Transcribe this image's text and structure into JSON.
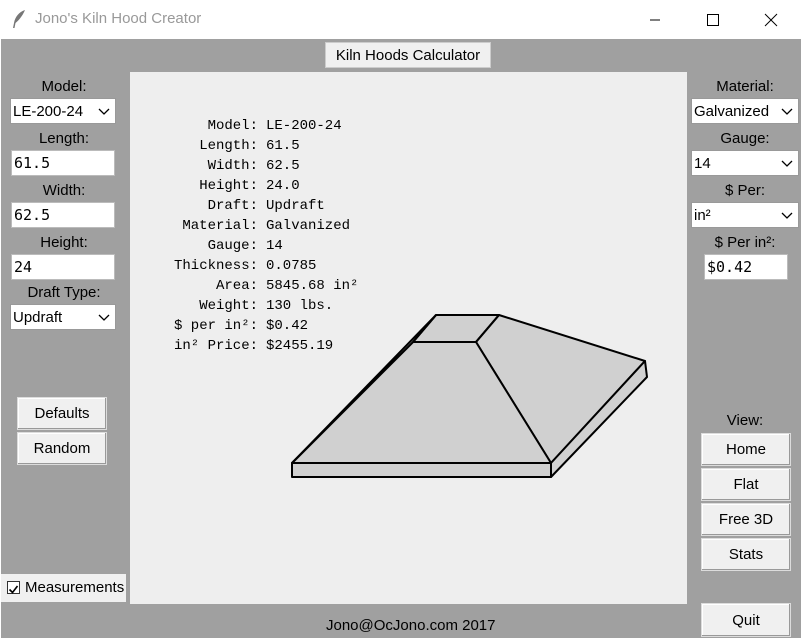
{
  "window": {
    "title": "Jono's Kiln Hood Creator",
    "minimize_icon": "minimize-icon",
    "maximize_icon": "maximize-icon",
    "close_icon": "close-icon",
    "app_icon": "feather-icon"
  },
  "header": {
    "calculator_label": "Kiln Hoods Calculator"
  },
  "left_panel": {
    "model_label": "Model:",
    "model_value": "LE-200-24",
    "length_label": "Length:",
    "length_value": "61.5",
    "width_label": "Width:",
    "width_value": "62.5",
    "height_label": "Height:",
    "height_value": "24",
    "draft_label": "Draft Type:",
    "draft_value": "Updraft",
    "defaults_label": "Defaults",
    "random_label": "Random",
    "measurements_label": "Measurements",
    "measurements_checked": true
  },
  "right_panel": {
    "material_label": "Material:",
    "material_value": "Galvanized",
    "gauge_label": "Gauge:",
    "gauge_value": "14",
    "per_label": "$ Per:",
    "per_value": "in²",
    "per_unit_label": "$ Per in²:",
    "per_unit_value": "$0.42",
    "view_label": "View:",
    "home_label": "Home",
    "flat_label": "Flat",
    "free3d_label": "Free 3D",
    "stats_label": "Stats",
    "quit_label": "Quit"
  },
  "stats": [
    {
      "key": "Model:",
      "value": "LE-200-24"
    },
    {
      "key": "Length:",
      "value": "61.5"
    },
    {
      "key": "Width:",
      "value": "62.5"
    },
    {
      "key": "Height:",
      "value": "24.0"
    },
    {
      "key": "Draft:",
      "value": "Updraft"
    },
    {
      "key": "Material:",
      "value": "Galvanized"
    },
    {
      "key": "Gauge:",
      "value": "14"
    },
    {
      "key": "Thickness:",
      "value": "0.0785"
    },
    {
      "key": "Area:",
      "value": "5845.68 in²"
    },
    {
      "key": "Weight:",
      "value": "130 lbs."
    },
    {
      "key": "$ per in²:",
      "value": "$0.42"
    },
    {
      "key": "in² Price:",
      "value": "$2455.19"
    }
  ],
  "footer": {
    "text": "Jono@OcJono.com 2017"
  }
}
